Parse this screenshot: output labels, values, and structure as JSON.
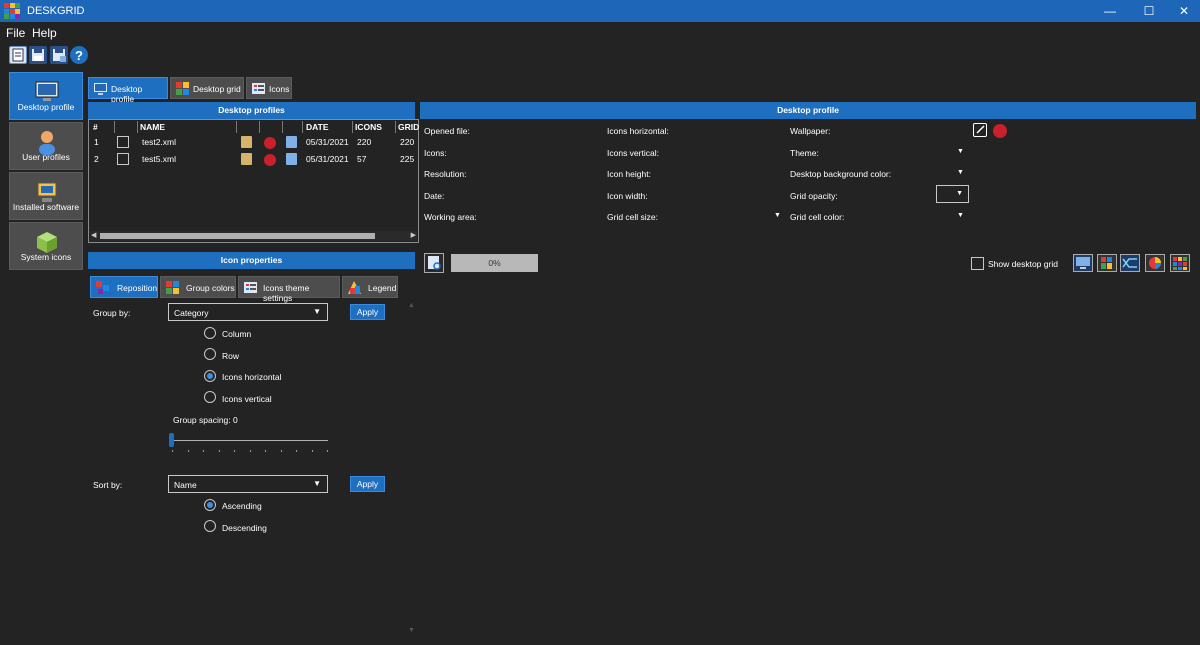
{
  "window": {
    "title": "DESKGRID",
    "minimize": "—",
    "maximize": "☐",
    "close": "✕"
  },
  "menu": {
    "file": "File",
    "help": "Help"
  },
  "toolbar": {
    "icons": [
      "new-profile-icon",
      "save-icon",
      "save-as-icon",
      "help-icon"
    ]
  },
  "sidebar": {
    "items": [
      {
        "label": "Desktop profile"
      },
      {
        "label": "User profiles"
      },
      {
        "label": "Installed software"
      },
      {
        "label": "System icons"
      }
    ]
  },
  "top_tabs": [
    {
      "label": "Desktop profile"
    },
    {
      "label": "Desktop grid"
    },
    {
      "label": "Icons"
    }
  ],
  "profiles": {
    "header": "Desktop profiles",
    "columns": [
      "#",
      "NAME",
      "DATE",
      "ICONS",
      "GRID"
    ],
    "rows": [
      {
        "num": "1",
        "name": "test2.xml",
        "date": "05/31/2021",
        "icons": "220",
        "grid": "220"
      },
      {
        "num": "2",
        "name": "test5.xml",
        "date": "05/31/2021",
        "icons": "57",
        "grid": "225"
      }
    ]
  },
  "desktop_profile": {
    "header": "Desktop profile",
    "col1": [
      "Opened file:",
      "Icons:",
      "Resolution:",
      "Date:",
      "Working area:"
    ],
    "col2": [
      "Icons horizontal:",
      "Icons vertical:",
      "Icon height:",
      "Icon width:",
      "Grid cell size:"
    ],
    "col3": [
      "Wallpaper:",
      "Theme:",
      "Desktop background color:",
      "Grid opacity:",
      "Grid cell color:"
    ]
  },
  "icon_properties": {
    "header": "Icon properties",
    "tabs": [
      {
        "label": "Reposition"
      },
      {
        "label": "Group colors"
      },
      {
        "label": "Icons theme settings"
      },
      {
        "label": "Legend"
      }
    ],
    "group_by_label": "Group by:",
    "group_by_value": "Category",
    "apply": "Apply",
    "group_options": [
      "Column",
      "Row",
      "Icons horizontal",
      "Icons vertical"
    ],
    "group_selected": 2,
    "group_spacing": "Group spacing: 0",
    "group_spacing_value": 0,
    "sort_by_label": "Sort by:",
    "sort_by_value": "Name",
    "sort_options": [
      "Ascending",
      "Descending"
    ],
    "sort_selected": 0
  },
  "progress": {
    "text": "0%",
    "value": 0
  },
  "show_desktop_grid": "Show desktop grid",
  "colors": {
    "accent": "#1e6fc0",
    "titlebar": "#1e67b8",
    "background": "#232323",
    "button": "#4d4d4d"
  }
}
